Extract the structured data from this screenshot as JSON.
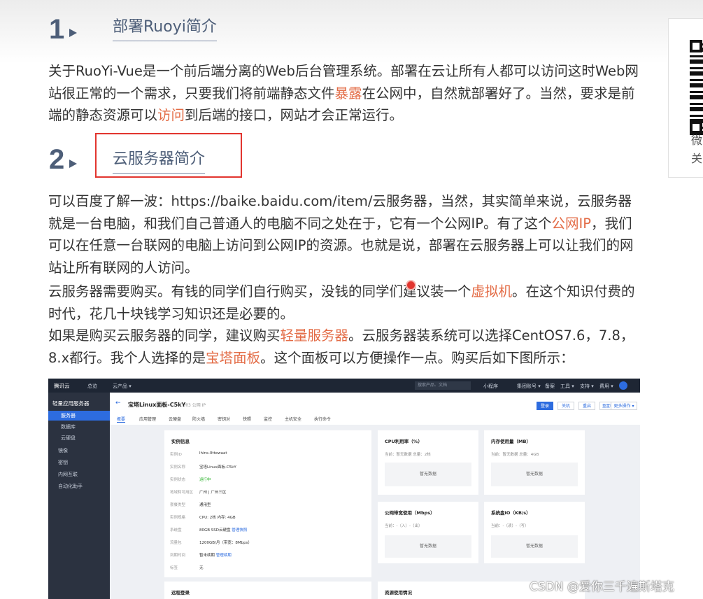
{
  "section1": {
    "number": "1",
    "title": "部署Ruoyi简介"
  },
  "para1": {
    "t1": "关于RuoYi-Vue是一个前后端分离的Web后台管理系统。部署在云让所有人都可以访问这时Web网站很正常的一个需求，只要我们将前端静态文件",
    "l1": "暴露",
    "t2": "在公网中，自然就部署好了。当然，要求是前端的静态资源可以",
    "l2": "访问",
    "t3": "到后端的接口，网站才会正常运行。"
  },
  "section2": {
    "number": "2",
    "title": "云服务器简介"
  },
  "para2": {
    "t1": "可以百度了解一波：https://baike.baidu.com/item/云服务器，当然，其实简单来说，云服务器就是一台电脑，和我们自己普通人的电脑不同之处在于，它有一个公网IP。有了这个",
    "l1": "公网IP",
    "t2": "，我们可以在任意一台联网的电脑上访问到公网IP的资源。也就是说，部署在云服务器上可以让我们的网站让所有联网的人访问。"
  },
  "para3": {
    "t1": "云服务器需要购买。有钱的同学们自行购买，没钱的同学们建议装一个",
    "l1": "虚拟机",
    "t2": "。在这个知识付费的时代，花几十块钱学习知识还是必要的。"
  },
  "para4": {
    "t1": "如果是购买云服务器的同学，建议购买",
    "l1": "轻量服务器",
    "t2": "。云服务器装系统可以选择CentOS7.6，7.8，8.x都行。我个人选择的是",
    "l2": "宝塔面板",
    "t3": "。这个面板可以方便操作一点。购买后如下图所示："
  },
  "sidebar_card": {
    "line1": "微",
    "line2": "关"
  },
  "screenshot": {
    "topbar": {
      "logo": "腾讯云",
      "home": "总览",
      "products": "云产品 ▾",
      "search": "搜索产品、文档",
      "miniapp": "小程序",
      "items": [
        "集团账号 ▾",
        "备案",
        "工具 ▾",
        "支持 ▾",
        "费用 ▾"
      ]
    },
    "sidebar": {
      "head": "轻量应用服务器",
      "items": [
        "服务器",
        "数据库",
        "云硬盘",
        "镜像",
        "密钥",
        "内网互联",
        "自动化助手"
      ]
    },
    "header": {
      "back": "←",
      "title": "宝塔Linux面板-C5kY",
      "subtitle": "广州3 公网 IP",
      "tabs": [
        "概要",
        "应用管理",
        "云硬盘",
        "防火墙",
        "密钥对",
        "快照",
        "监控",
        "主机安全",
        "执行命令"
      ],
      "buttons": [
        "登录",
        "关机",
        "重启",
        "重置密码",
        "续费",
        "更多操作 ▾"
      ]
    },
    "info": {
      "title": "实例信息",
      "rows": [
        {
          "k": "实例ID",
          "v": "lhins-0ttewaat"
        },
        {
          "k": "实例名称",
          "v": "宝塔Linux面板-C5kY"
        },
        {
          "k": "实例状态",
          "v": "运行中"
        },
        {
          "k": "地域和可用区",
          "v": "广州 | 广州三区"
        },
        {
          "k": "套餐类型",
          "v": "通用型"
        },
        {
          "k": "实例规格",
          "v": "CPU: 2核 内存: 4GB"
        },
        {
          "k": "系统盘",
          "v": "80GB SSD云硬盘",
          "link": "管理快照"
        },
        {
          "k": "流量包",
          "v": "1200GB/月（带宽：8Mbps）"
        },
        {
          "k": "到期时间",
          "v": "暂未续期",
          "link": "管理续期"
        },
        {
          "k": "标签",
          "v": "无"
        }
      ],
      "footer": "远程登录"
    },
    "cards": [
      {
        "title": "CPU利用率（%）",
        "sub": "当前：暂无数据 总量：2核",
        "empty": "暂无数据"
      },
      {
        "title": "内存使用量（MB）",
        "sub": "当前：暂无数据 总量：4GB",
        "empty": "暂无数据"
      },
      {
        "title": "公网带宽使用（Mbps）",
        "sub": "当前：-（入）-（出）",
        "empty": "暂无数据"
      },
      {
        "title": "系统盘IO（KB/s）",
        "sub": "当前：-（读）-（写）",
        "empty": "暂无数据"
      }
    ],
    "bottom_card": "资源使用情况"
  },
  "watermark": "CSDN @爱你三千遍斯塔克"
}
